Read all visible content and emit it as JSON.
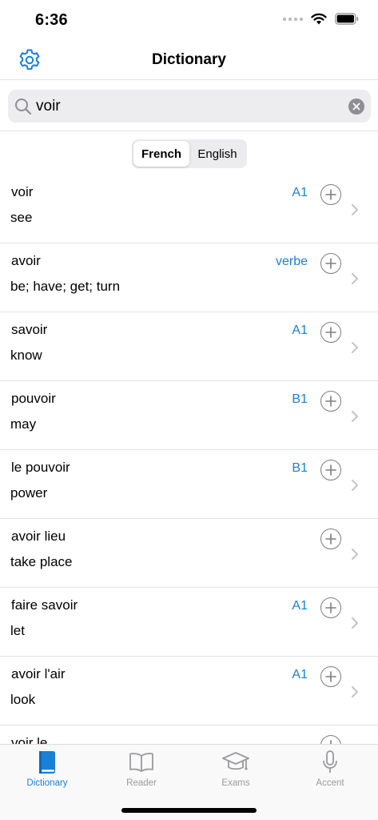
{
  "status": {
    "time": "6:36"
  },
  "nav": {
    "title": "Dictionary"
  },
  "search": {
    "value": "voir"
  },
  "segments": [
    {
      "label": "French",
      "active": true
    },
    {
      "label": "English",
      "active": false
    }
  ],
  "colors": {
    "accent": "#1a7fd9",
    "inactive": "#9a9a9f"
  },
  "entries": [
    {
      "word": "voir",
      "translation": "see",
      "level": "A1"
    },
    {
      "word": "avoir",
      "translation": "be; have; get; turn",
      "level": "verbe"
    },
    {
      "word": "savoir",
      "translation": "know",
      "level": "A1"
    },
    {
      "word": "pouvoir",
      "translation": "may",
      "level": "B1"
    },
    {
      "word": "le pouvoir",
      "translation": "power",
      "level": "B1"
    },
    {
      "word": "avoir lieu",
      "translation": "take place",
      "level": ""
    },
    {
      "word": "faire savoir",
      "translation": "let",
      "level": "A1"
    },
    {
      "word": "avoir l'air",
      "translation": "look",
      "level": "A1"
    },
    {
      "word": "voir le",
      "translation": "",
      "level": ""
    }
  ],
  "tabs": [
    {
      "label": "Dictionary",
      "icon": "book-icon",
      "active": true
    },
    {
      "label": "Reader",
      "icon": "open-book-icon",
      "active": false
    },
    {
      "label": "Exams",
      "icon": "graduation-cap-icon",
      "active": false
    },
    {
      "label": "Accent",
      "icon": "microphone-icon",
      "active": false
    }
  ]
}
